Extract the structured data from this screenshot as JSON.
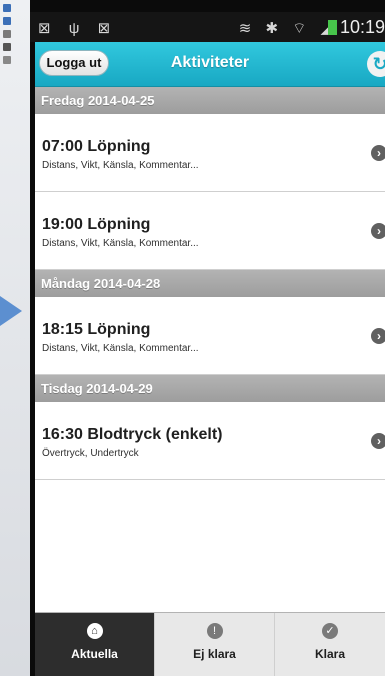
{
  "statusbar": {
    "left_icons": "⊠ ψ ⊠",
    "right_icons": "≋ ✱ ⌔ ◢",
    "time": "10:19"
  },
  "header": {
    "logout_label": "Logga ut",
    "title": "Aktiviteter",
    "refresh_icon": "refresh-icon"
  },
  "days": [
    {
      "label": "Fredag 2014-04-25",
      "items": [
        {
          "title": "07:00 Löpning",
          "subtitle": "Distans, Vikt, Känsla, Kommentar..."
        },
        {
          "title": "19:00 Löpning",
          "subtitle": "Distans, Vikt, Känsla, Kommentar..."
        }
      ]
    },
    {
      "label": "Måndag 2014-04-28",
      "items": [
        {
          "title": "18:15 Löpning",
          "subtitle": "Distans, Vikt, Känsla, Kommentar..."
        }
      ]
    },
    {
      "label": "Tisdag 2014-04-29",
      "items": [
        {
          "title": "16:30 Blodtryck (enkelt)",
          "subtitle": "Övertryck, Undertryck"
        }
      ]
    }
  ],
  "tabs": [
    {
      "label": "Aktuella",
      "icon": "home-icon",
      "active": true
    },
    {
      "label": "Ej klara",
      "icon": "warning-icon",
      "active": false
    },
    {
      "label": "Klara",
      "icon": "check-icon",
      "active": false
    }
  ],
  "colors": {
    "header_accent": "#1aa9c4",
    "day_header": "#a6a6a6",
    "active_tab": "#2d2d2d"
  }
}
